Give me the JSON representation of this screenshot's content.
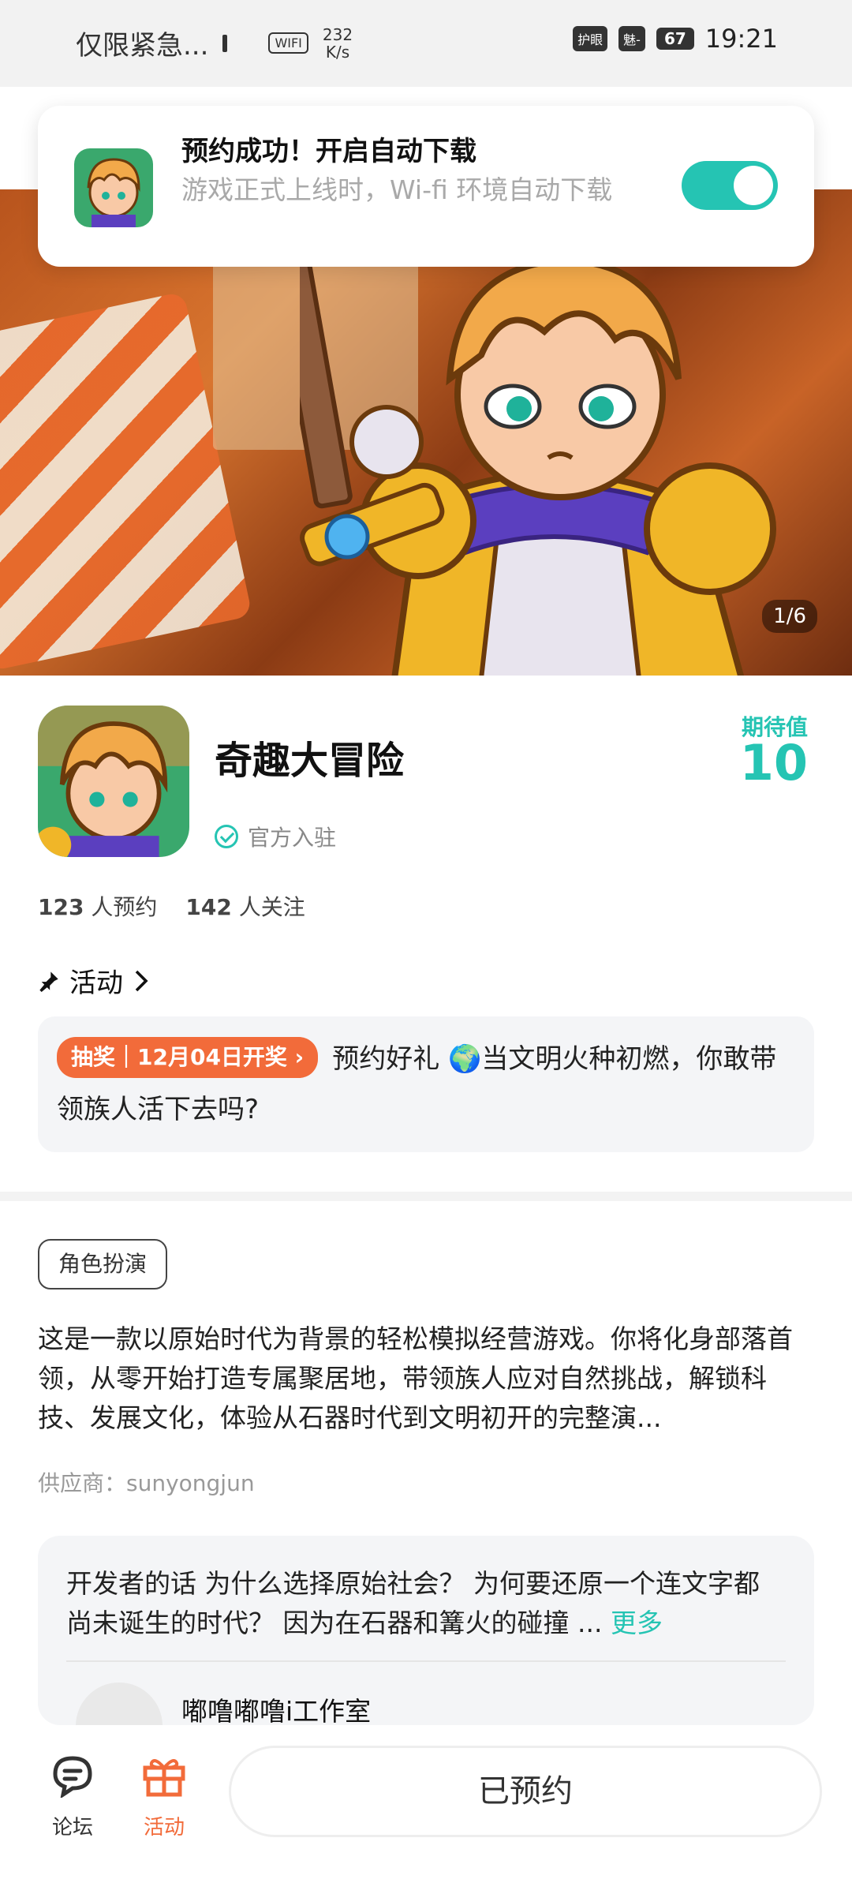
{
  "status_bar": {
    "notification_text": "仅限紧急...",
    "wifi_label": "WIFI",
    "speed_value": "232",
    "speed_unit": "K/s",
    "eye_label": "护眼",
    "second_pill": "魅-",
    "battery": "67",
    "time": "19:21"
  },
  "toast": {
    "title": "预约成功！开启自动下载",
    "subtitle": "游戏正式上线时，Wi-fi 环境自动下载",
    "toggle_on": true
  },
  "hero": {
    "counter": "1/6"
  },
  "app": {
    "name": "奇趣大冒险",
    "official_label": "官方入驻",
    "expect_label": "期待值",
    "expect_value": "10"
  },
  "stats": {
    "reserve_count": "123",
    "reserve_label": "人预约",
    "follow_count": "142",
    "follow_label": "人关注"
  },
  "activity": {
    "heading": "活动",
    "lottery_label": "抽奖｜12月04日开奖",
    "text": "预约好礼 🌍当文明火种初燃，你敢带领族人活下去吗?"
  },
  "tag": "角色扮演",
  "description": "这是一款以原始时代为背景的轻松模拟经营游戏。你将化身部落首领，从零开始打造专属聚居地，带领族人应对自然挑战，解锁科技、发展文化，体验从石器时代到文明初开的完整演...",
  "supplier": "供应商：sunyongjun",
  "developer": {
    "text": "开发者的话  为什么选择原始社会？ 为何要还原一个连文字都尚未诞生的时代？ 因为在石器和篝火的碰撞 ...",
    "more": "更多",
    "studio": "嘟噜嘟噜i工作室"
  },
  "bottom_nav": {
    "forum": "论坛",
    "activity": "活动",
    "reserve_button": "已预约"
  },
  "colors": {
    "accent": "#25c4b3",
    "orange": "#f26b3a"
  }
}
